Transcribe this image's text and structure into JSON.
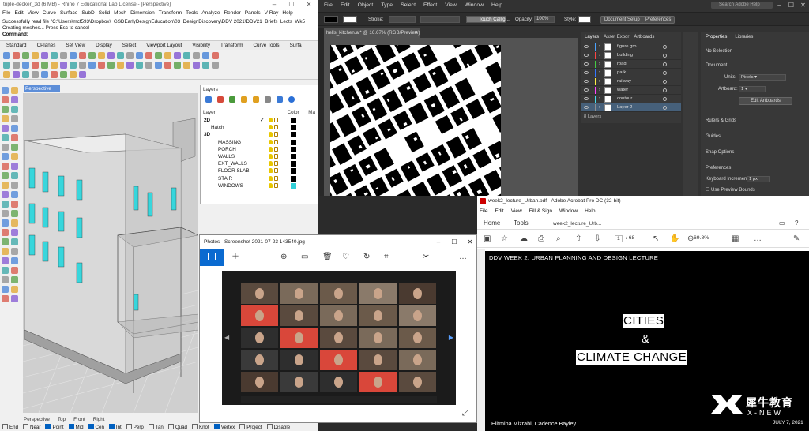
{
  "rhino": {
    "title": "triple-decker_3d (6 MB) - Rhino 7 Educational Lab License - [Perspective]",
    "menu": [
      "File",
      "Edit",
      "View",
      "Curve",
      "Surface",
      "SubD",
      "Solid",
      "Mesh",
      "Dimension",
      "Transform",
      "Tools",
      "Analyze",
      "Render",
      "Panels",
      "V-Ray",
      "Help"
    ],
    "history": [
      "Successfully read file \"C:\\Users\\mcf593\\Dropbox\\_GSDEarlyDesignEducation\\03_DesignDiscovery\\DDV 2021\\DDV21_Briefs_Lects_Wk5",
      "Creating meshes... Press Esc to cancel"
    ],
    "command_label": "Command:",
    "tabs": [
      "Standard",
      "CPlanes",
      "Set View",
      "Display",
      "Select",
      "Viewport Layout",
      "Visibility",
      "Transform",
      "Curve Tools",
      "Surfa"
    ],
    "viewport_label": "Perspective",
    "layers_title": "Layers",
    "layer_cols": {
      "layer": "Layer",
      "color": "Color",
      "ma": "Ma"
    },
    "layers": [
      {
        "name": "2D",
        "indent": 0,
        "bold": true,
        "check": true,
        "color": "#000000"
      },
      {
        "name": "Hatch",
        "indent": 1,
        "color": "#000000"
      },
      {
        "name": "3D",
        "indent": 0,
        "bold": true,
        "color": "#000000"
      },
      {
        "name": "MASSING",
        "indent": 2,
        "color": "#000000"
      },
      {
        "name": "PORCH",
        "indent": 2,
        "color": "#000000"
      },
      {
        "name": "WALLS",
        "indent": 2,
        "color": "#000000"
      },
      {
        "name": "EXT_WALLS",
        "indent": 2,
        "color": "#000000"
      },
      {
        "name": "FLOOR SLAB",
        "indent": 2,
        "color": "#000000"
      },
      {
        "name": "STAIR",
        "indent": 2,
        "color": "#000000"
      },
      {
        "name": "WINDOWS",
        "indent": 2,
        "color": "#33d0d8"
      }
    ],
    "viewport_tabs": [
      "Perspective",
      "Top",
      "Front",
      "Right"
    ],
    "osnaps": [
      {
        "label": "End",
        "on": false
      },
      {
        "label": "Near",
        "on": false
      },
      {
        "label": "Point",
        "on": true
      },
      {
        "label": "Mid",
        "on": true
      },
      {
        "label": "Cen",
        "on": true
      },
      {
        "label": "Int",
        "on": true
      },
      {
        "label": "Perp",
        "on": false
      },
      {
        "label": "Tan",
        "on": false
      },
      {
        "label": "Quad",
        "on": false
      },
      {
        "label": "Knot",
        "on": false
      },
      {
        "label": "Vertex",
        "on": true
      },
      {
        "label": "Project",
        "on": false
      },
      {
        "label": "Disable",
        "on": false
      }
    ]
  },
  "illustrator": {
    "menu": [
      "File",
      "Edit",
      "Object",
      "Type",
      "Select",
      "Effect",
      "View",
      "Window",
      "Help"
    ],
    "search_placeholder": "Search Adobe Help",
    "stroke_label": "Stroke:",
    "brush_label": "Touch Callig...",
    "opacity_label": "Opacity:",
    "opacity_value": "100%",
    "style_label": "Style:",
    "doc_setup": "Document Setup",
    "preferences": "Preferences",
    "doc_tab": "hells_kitchen.ai* @ 16.67% (RGB/Preview)",
    "layers_tabs": [
      "Layers",
      "Asset Expor",
      "Artboards"
    ],
    "layers": [
      {
        "name": "figure gro...",
        "color": "#4aa3ff"
      },
      {
        "name": "building",
        "color": "#ff4444"
      },
      {
        "name": "road",
        "color": "#44cc44"
      },
      {
        "name": "park",
        "color": "#3377ff"
      },
      {
        "name": "railway",
        "color": "#ffee44"
      },
      {
        "name": "water",
        "color": "#ff44ff"
      },
      {
        "name": "contour",
        "color": "#44ddee"
      },
      {
        "name": "Layer 2",
        "color": "#8f8f8f",
        "selected": true
      }
    ],
    "layers_count": "8 Layers",
    "props_tabs": [
      "Properties",
      "Libraries"
    ],
    "no_selection": "No Selection",
    "document_label": "Document",
    "units_label": "Units:",
    "units_value": "Pixels",
    "artboard_label": "Artboard:",
    "artboard_value": "1",
    "edit_artboards": "Edit Artboards",
    "rulers_grids": "Rulers & Grids",
    "guides": "Guides",
    "snap_options": "Snap Options",
    "preferences_sec": "Preferences",
    "kb_increment_label": "Keyboard Increment:",
    "kb_increment_value": "1 px",
    "use_preview_bounds": "Use Preview Bounds"
  },
  "photos": {
    "title": "Photos - Screenshot 2021-07-23 143540.jpg"
  },
  "acrobat": {
    "title": "week2_lecture_Urban.pdf - Adobe Acrobat Pro DC (32-bit)",
    "menu": [
      "File",
      "Edit",
      "View",
      "Fill & Sign",
      "Window",
      "Help"
    ],
    "nav": [
      "Home",
      "Tools",
      "week2_lecture_Urb..."
    ],
    "page_current": "1",
    "page_total": "/ 68",
    "zoom": "69.8%",
    "slide": {
      "header": "DDV WEEK 2: URBAN PLANNING AND DESIGN LECTURE",
      "line1": "CITIES",
      "line2": "&",
      "line3": "CLIMATE CHANGE",
      "authors": "Elifmina Mizrahi, Cadence Bayley",
      "date": "JULY 7, 2021"
    }
  },
  "watermark": {
    "cn": "犀牛教育",
    "en": "X-NEW"
  }
}
